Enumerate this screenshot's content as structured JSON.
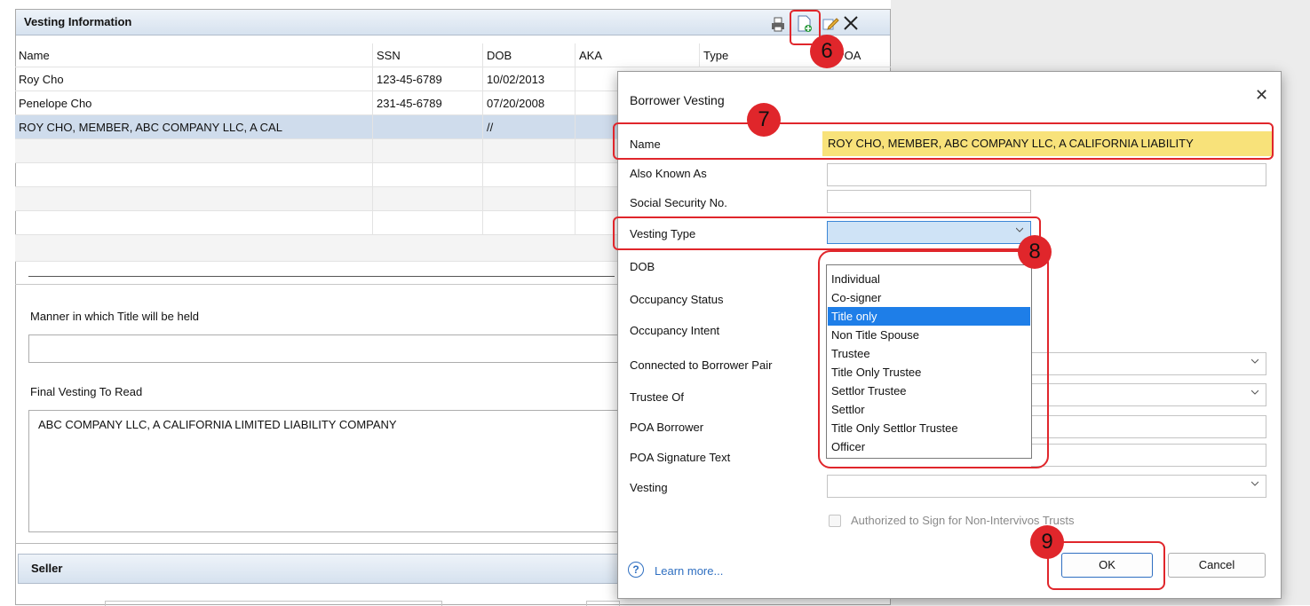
{
  "vesting_info": {
    "title": "Vesting Information",
    "columns": [
      "Name",
      "SSN",
      "DOB",
      "AKA",
      "Type",
      "POA"
    ],
    "rows": [
      {
        "name": "Roy Cho",
        "ssn": "123-45-6789",
        "dob": "10/02/2013"
      },
      {
        "name": "Penelope Cho",
        "ssn": "231-45-6789",
        "dob": "07/20/2008"
      },
      {
        "name": "ROY CHO, MEMBER, ABC COMPANY LLC, A CAL",
        "ssn": "",
        "dob": "//"
      }
    ],
    "manner_label": "Manner in which Title will be held",
    "manner_value": "",
    "final_label": "Final Vesting To Read",
    "final_value": "ABC COMPANY LLC, A CALIFORNIA LIMITED LIABILITY COMPANY"
  },
  "seller": {
    "title": "Seller"
  },
  "dialog": {
    "title": "Borrower Vesting",
    "close": "✕",
    "fields": {
      "name_label": "Name",
      "name_value": "ROY CHO, MEMBER, ABC COMPANY LLC, A CALIFORNIA LIABILITY",
      "aka_label": "Also Known As",
      "ssn_label": "Social Security No.",
      "vtype_label": "Vesting Type",
      "dob_label": "DOB",
      "occ_status_label": "Occupancy Status",
      "occ_intent_label": "Occupancy Intent",
      "pair_label": "Connected to Borrower Pair",
      "trustee_label": "Trustee Of",
      "poa_borrower_label": "POA Borrower",
      "poa_sig_label": "POA Signature Text",
      "vesting_label": "Vesting"
    },
    "vesting_type_options": [
      "Individual",
      "Co-signer",
      "Title only",
      "Non Title Spouse",
      "Trustee",
      "Title Only Trustee",
      "Settlor Trustee",
      "Settlor",
      "Title Only Settlor Trustee",
      "Officer"
    ],
    "vesting_type_highlighted": "Title only",
    "authorized_label": "Authorized to Sign for Non-Intervivos Trusts",
    "learn_more": "Learn more...",
    "ok": "OK",
    "cancel": "Cancel"
  },
  "callouts": [
    "6",
    "7",
    "8",
    "9"
  ],
  "colors": {
    "annotation_red": "#e0262b",
    "highlight_yellow": "#f8e27a",
    "selection_blue": "#1e7ee8"
  }
}
